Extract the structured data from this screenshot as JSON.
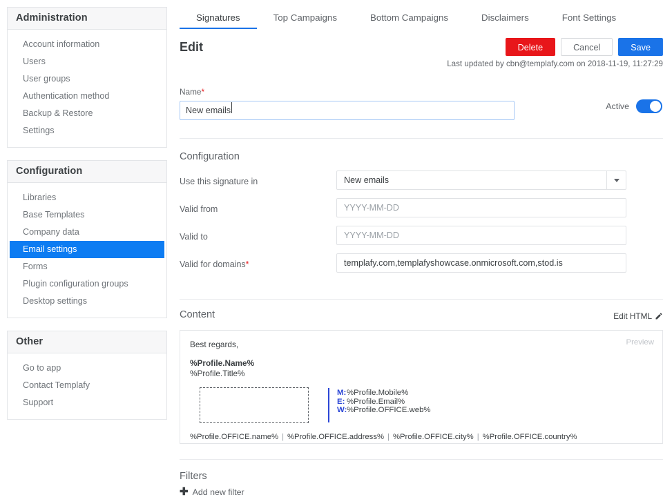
{
  "sidebar": {
    "panels": [
      {
        "title": "Administration",
        "items": [
          {
            "label": "Account information",
            "active": false
          },
          {
            "label": "Users",
            "active": false
          },
          {
            "label": "User groups",
            "active": false
          },
          {
            "label": "Authentication method",
            "active": false
          },
          {
            "label": "Backup & Restore",
            "active": false
          },
          {
            "label": "Settings",
            "active": false
          }
        ]
      },
      {
        "title": "Configuration",
        "items": [
          {
            "label": "Libraries",
            "active": false
          },
          {
            "label": "Base Templates",
            "active": false
          },
          {
            "label": "Company data",
            "active": false
          },
          {
            "label": "Email settings",
            "active": true
          },
          {
            "label": "Forms",
            "active": false
          },
          {
            "label": "Plugin configuration groups",
            "active": false
          },
          {
            "label": "Desktop settings",
            "active": false
          }
        ]
      },
      {
        "title": "Other",
        "items": [
          {
            "label": "Go to app",
            "active": false
          },
          {
            "label": "Contact Templafy",
            "active": false
          },
          {
            "label": "Support",
            "active": false
          }
        ]
      }
    ]
  },
  "tabs": [
    {
      "label": "Signatures",
      "active": true
    },
    {
      "label": "Top Campaigns",
      "active": false
    },
    {
      "label": "Bottom Campaigns",
      "active": false
    },
    {
      "label": "Disclaimers",
      "active": false
    },
    {
      "label": "Font Settings",
      "active": false
    }
  ],
  "header": {
    "title": "Edit",
    "delete_label": "Delete",
    "cancel_label": "Cancel",
    "save_label": "Save",
    "last_updated": "Last updated by cbn@templafy.com on 2018-11-19, 11:27:29"
  },
  "name_field": {
    "label": "Name",
    "required_mark": "*",
    "value": "New emails",
    "active_label": "Active",
    "active_state": "on"
  },
  "configuration": {
    "title": "Configuration",
    "rows": [
      {
        "label": "Use this signature in",
        "required_mark": "",
        "value": "New emails",
        "placeholder": "",
        "type": "select"
      },
      {
        "label": "Valid from",
        "required_mark": "",
        "value": "",
        "placeholder": "YYYY-MM-DD",
        "type": "text"
      },
      {
        "label": "Valid to",
        "required_mark": "",
        "value": "",
        "placeholder": "YYYY-MM-DD",
        "type": "text"
      },
      {
        "label": "Valid for domains",
        "required_mark": "*",
        "value": "templafy.com,templafyshowcase.onmicrosoft.com,stod.is",
        "placeholder": "",
        "type": "text"
      }
    ]
  },
  "content": {
    "title": "Content",
    "edit_html_label": "Edit HTML",
    "edit_html_icon": "pencil-icon",
    "preview_label": "Preview",
    "signature": {
      "greeting": "Best regards,",
      "name_placeholder": "%Profile.Name%",
      "title_placeholder": "%Profile.Title%",
      "contacts": [
        {
          "key": "M:",
          "value": "%Profile.Mobile%"
        },
        {
          "key": "E:",
          "value": "%Profile.Email%"
        },
        {
          "key": "W:",
          "value": "%Profile.OFFICE.web%"
        }
      ],
      "footer_parts": [
        "%Profile.OFFICE.name%",
        "%Profile.OFFICE.address%",
        "%Profile.OFFICE.city%",
        "%Profile.OFFICE.country%"
      ],
      "footer_separator": "|"
    }
  },
  "filters": {
    "title": "Filters",
    "add_label": "Add new filter",
    "add_icon": "plus-icon"
  },
  "colors": {
    "accent_blue": "#1a73e8",
    "highlight_blue": "#0d7cf2",
    "danger_red": "#e8161a",
    "signature_blue": "#2b46d6",
    "text": "#3c4043",
    "muted": "#5f6368"
  }
}
